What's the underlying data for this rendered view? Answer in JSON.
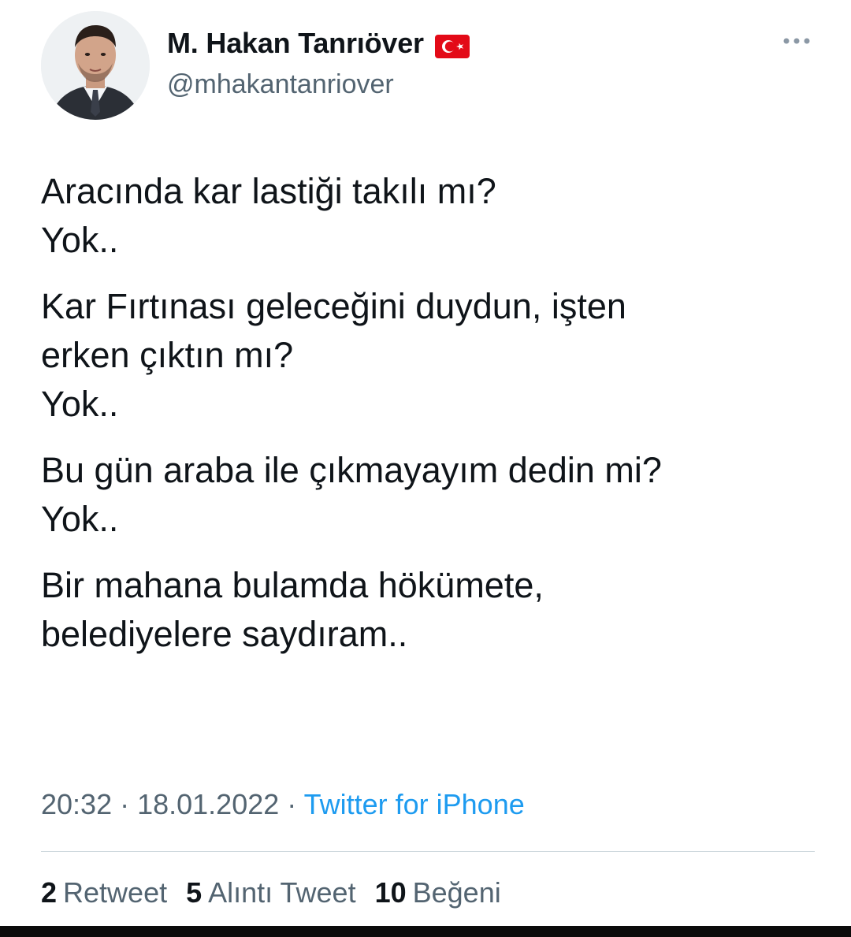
{
  "author": {
    "name": "M. Hakan Tanrıöver",
    "handle": "@mhakantanriover",
    "badge_icon": "turkish-flag-icon"
  },
  "menu": {
    "icon": "more-options-icon"
  },
  "tweet": {
    "paragraphs": [
      {
        "lines": [
          "Aracında kar lastiği takılı mı?",
          "Yok.."
        ]
      },
      {
        "lines": [
          "Kar Fırtınası geleceğini duydun, işten",
          "erken çıktın mı?",
          "Yok.."
        ]
      },
      {
        "lines": [
          "Bu gün araba ile çıkmayayım dedin mi?",
          "Yok.."
        ]
      },
      {
        "lines": [
          "Bir mahana bulamda hökümete,",
          "belediyelere saydıram.."
        ]
      }
    ]
  },
  "meta": {
    "time": "20:32",
    "sep1": " · ",
    "date": "18.01.2022",
    "sep2": " · ",
    "source": "Twitter for iPhone"
  },
  "stats": {
    "retweets": {
      "count": "2",
      "label": "Retweet"
    },
    "quotes": {
      "count": "5",
      "label": "Alıntı Tweet"
    },
    "likes": {
      "count": "10",
      "label": "Beğeni"
    }
  },
  "colors": {
    "text": "#0f1419",
    "secondary": "#536471",
    "link": "#1d9bf0",
    "flag_red": "#e30a17"
  }
}
